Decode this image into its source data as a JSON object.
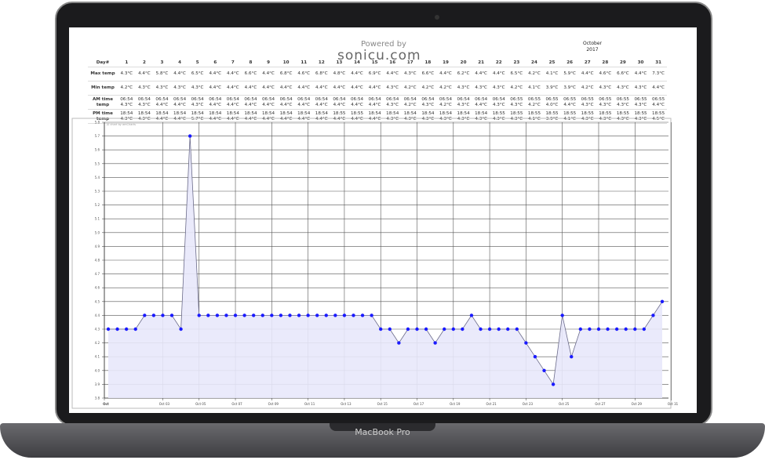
{
  "device": {
    "label": "MacBook Pro"
  },
  "header": {
    "powered_by": "Powered by",
    "logo": "sonicu.com",
    "month": "October",
    "year": "2017"
  },
  "table": {
    "day_label": "Day#",
    "row_labels": [
      "Max temp",
      "Min temp",
      "AM time temp",
      "PM time temp"
    ],
    "days": [
      1,
      2,
      3,
      4,
      5,
      6,
      7,
      8,
      9,
      10,
      11,
      12,
      13,
      14,
      15,
      16,
      17,
      18,
      19,
      20,
      21,
      22,
      23,
      24,
      25,
      26,
      27,
      28,
      29,
      30,
      31
    ],
    "max": [
      "4.3°C",
      "4.4°C",
      "5.8°C",
      "4.4°C",
      "6.5°C",
      "4.4°C",
      "4.4°C",
      "6.6°C",
      "4.4°C",
      "6.8°C",
      "4.6°C",
      "6.8°C",
      "4.8°C",
      "4.4°C",
      "6.9°C",
      "4.4°C",
      "4.3°C",
      "6.6°C",
      "4.4°C",
      "6.2°C",
      "4.4°C",
      "4.4°C",
      "6.5°C",
      "4.2°C",
      "4.1°C",
      "5.9°C",
      "4.4°C",
      "4.6°C",
      "6.6°C",
      "4.4°C",
      "7.3°C"
    ],
    "min": [
      "4.2°C",
      "4.3°C",
      "4.3°C",
      "4.3°C",
      "4.3°C",
      "4.4°C",
      "4.4°C",
      "4.4°C",
      "4.4°C",
      "4.4°C",
      "4.4°C",
      "4.4°C",
      "4.4°C",
      "4.4°C",
      "4.4°C",
      "4.3°C",
      "4.2°C",
      "4.2°C",
      "4.2°C",
      "4.3°C",
      "4.3°C",
      "4.3°C",
      "4.2°C",
      "4.1°C",
      "3.9°C",
      "3.9°C",
      "4.2°C",
      "4.3°C",
      "4.3°C",
      "4.3°C",
      "4.4°C"
    ],
    "am_time": [
      "06:54",
      "06:54",
      "06:54",
      "06:54",
      "06:54",
      "06:54",
      "06:54",
      "06:54",
      "06:54",
      "06:54",
      "06:54",
      "06:54",
      "06:54",
      "06:54",
      "06:54",
      "06:54",
      "06:54",
      "06:54",
      "06:54",
      "06:54",
      "06:54",
      "06:54",
      "06:55",
      "06:55",
      "06:55",
      "06:55",
      "06:55",
      "06:55",
      "06:55",
      "06:55",
      "06:55"
    ],
    "am_temp": [
      "4.3°C",
      "4.3°C",
      "4.4°C",
      "4.4°C",
      "4.3°C",
      "4.4°C",
      "4.4°C",
      "4.4°C",
      "4.4°C",
      "4.4°C",
      "4.4°C",
      "4.4°C",
      "4.4°C",
      "4.4°C",
      "4.4°C",
      "4.3°C",
      "4.2°C",
      "4.3°C",
      "4.2°C",
      "4.3°C",
      "4.4°C",
      "4.3°C",
      "4.3°C",
      "4.2°C",
      "4.0°C",
      "4.4°C",
      "4.3°C",
      "4.3°C",
      "4.3°C",
      "4.3°C",
      "4.4°C"
    ],
    "pm_time": [
      "18:54",
      "18:54",
      "18:54",
      "18:54",
      "18:54",
      "18:54",
      "18:54",
      "18:54",
      "18:54",
      "18:54",
      "18:54",
      "18:54",
      "18:55",
      "18:55",
      "18:54",
      "18:54",
      "18:54",
      "18:54",
      "18:54",
      "18:54",
      "18:54",
      "18:55",
      "18:55",
      "18:55",
      "18:55",
      "18:55",
      "18:55",
      "18:55",
      "18:55",
      "18:55",
      "18:55"
    ],
    "pm_temp": [
      "4.3°C",
      "4.3°C",
      "4.4°C",
      "4.4°C",
      "5.7°C",
      "4.4°C",
      "4.4°C",
      "4.4°C",
      "4.4°C",
      "4.4°C",
      "4.4°C",
      "4.4°C",
      "4.4°C",
      "4.4°C",
      "4.4°C",
      "4.3°C",
      "4.3°C",
      "4.3°C",
      "4.3°C",
      "4.3°C",
      "4.3°C",
      "4.3°C",
      "4.3°C",
      "4.1°C",
      "3.9°C",
      "4.1°C",
      "4.3°C",
      "4.3°C",
      "4.3°C",
      "4.3°C",
      "4.5°C"
    ]
  },
  "chart_data": {
    "type": "area",
    "credit": "JS chart by amCharts",
    "ylim": [
      3.8,
      5.8
    ],
    "yticks": [
      "3.8",
      "3.9",
      "4.0",
      "4.1",
      "4.2",
      "4.3",
      "4.4",
      "4.5",
      "4.6",
      "4.7",
      "4.8",
      "4.9",
      "5.0",
      "5.1",
      "5.2",
      "5.3",
      "5.4",
      "5.5",
      "5.6",
      "5.7",
      "5.8"
    ],
    "xticks": [
      "Oct",
      "Oct 03",
      "Oct 05",
      "Oct 07",
      "Oct 09",
      "Oct 11",
      "Oct 13",
      "Oct 15",
      "Oct 17",
      "Oct 19",
      "Oct 21",
      "Oct 23",
      "Oct 25",
      "Oct 27",
      "Oct 29",
      "Oct 31"
    ],
    "values": [
      4.3,
      4.3,
      4.3,
      4.3,
      4.4,
      4.4,
      4.4,
      4.4,
      4.3,
      5.7,
      4.4,
      4.4,
      4.4,
      4.4,
      4.4,
      4.4,
      4.4,
      4.4,
      4.4,
      4.4,
      4.4,
      4.4,
      4.4,
      4.4,
      4.4,
      4.4,
      4.4,
      4.4,
      4.4,
      4.4,
      4.3,
      4.3,
      4.2,
      4.3,
      4.3,
      4.3,
      4.2,
      4.3,
      4.3,
      4.3,
      4.4,
      4.3,
      4.3,
      4.3,
      4.3,
      4.3,
      4.2,
      4.1,
      4.0,
      3.9,
      4.4,
      4.1,
      4.3,
      4.3,
      4.3,
      4.3,
      4.3,
      4.3,
      4.3,
      4.3,
      4.4,
      4.5
    ],
    "line_color": "#6b6b8a",
    "point_color": "#1a1aff",
    "fill_color": "#e8e8fb"
  }
}
